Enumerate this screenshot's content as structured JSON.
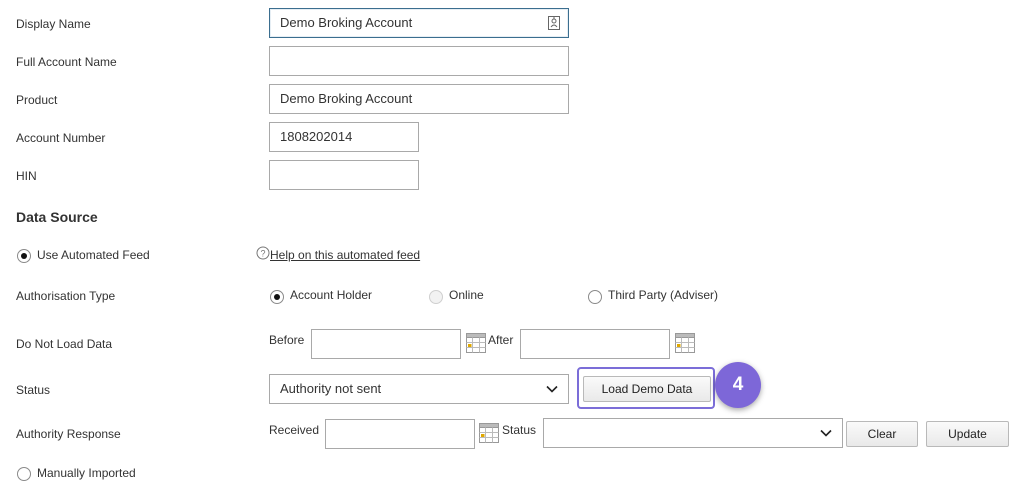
{
  "fields": {
    "display_name": {
      "label": "Display Name",
      "value": "Demo Broking Account"
    },
    "full_account_name": {
      "label": "Full Account Name",
      "value": ""
    },
    "product": {
      "label": "Product",
      "value": "Demo Broking Account"
    },
    "account_number": {
      "label": "Account Number",
      "value": "1808202014"
    },
    "hin": {
      "label": "HIN",
      "value": ""
    }
  },
  "data_source": {
    "title": "Data Source",
    "automated_feed_label": "Use Automated Feed",
    "help_link": "Help on this automated feed",
    "manually_imported_label": "Manually Imported"
  },
  "authorisation": {
    "label": "Authorisation Type",
    "options": [
      "Account Holder",
      "Online",
      "Third Party (Adviser)"
    ],
    "selected": "Account Holder"
  },
  "do_not_load": {
    "label": "Do Not Load Data",
    "before_label": "Before",
    "after_label": "After",
    "before_value": "",
    "after_value": ""
  },
  "status": {
    "label": "Status",
    "value": "Authority not sent",
    "load_demo_button": "Load Demo Data"
  },
  "authority_response": {
    "label": "Authority Response",
    "received_label": "Received",
    "received_value": "",
    "status_label": "Status",
    "status_value": "",
    "clear_button": "Clear",
    "update_button": "Update"
  },
  "step_badge": "4",
  "icons": {
    "calendar": "calendar-icon",
    "chevron": "chevron-down-icon",
    "help": "help-circle-icon",
    "contact_card": "contact-card-icon"
  },
  "colors": {
    "highlight": "#7d67d8",
    "focus_border": "#3b6e8f"
  }
}
